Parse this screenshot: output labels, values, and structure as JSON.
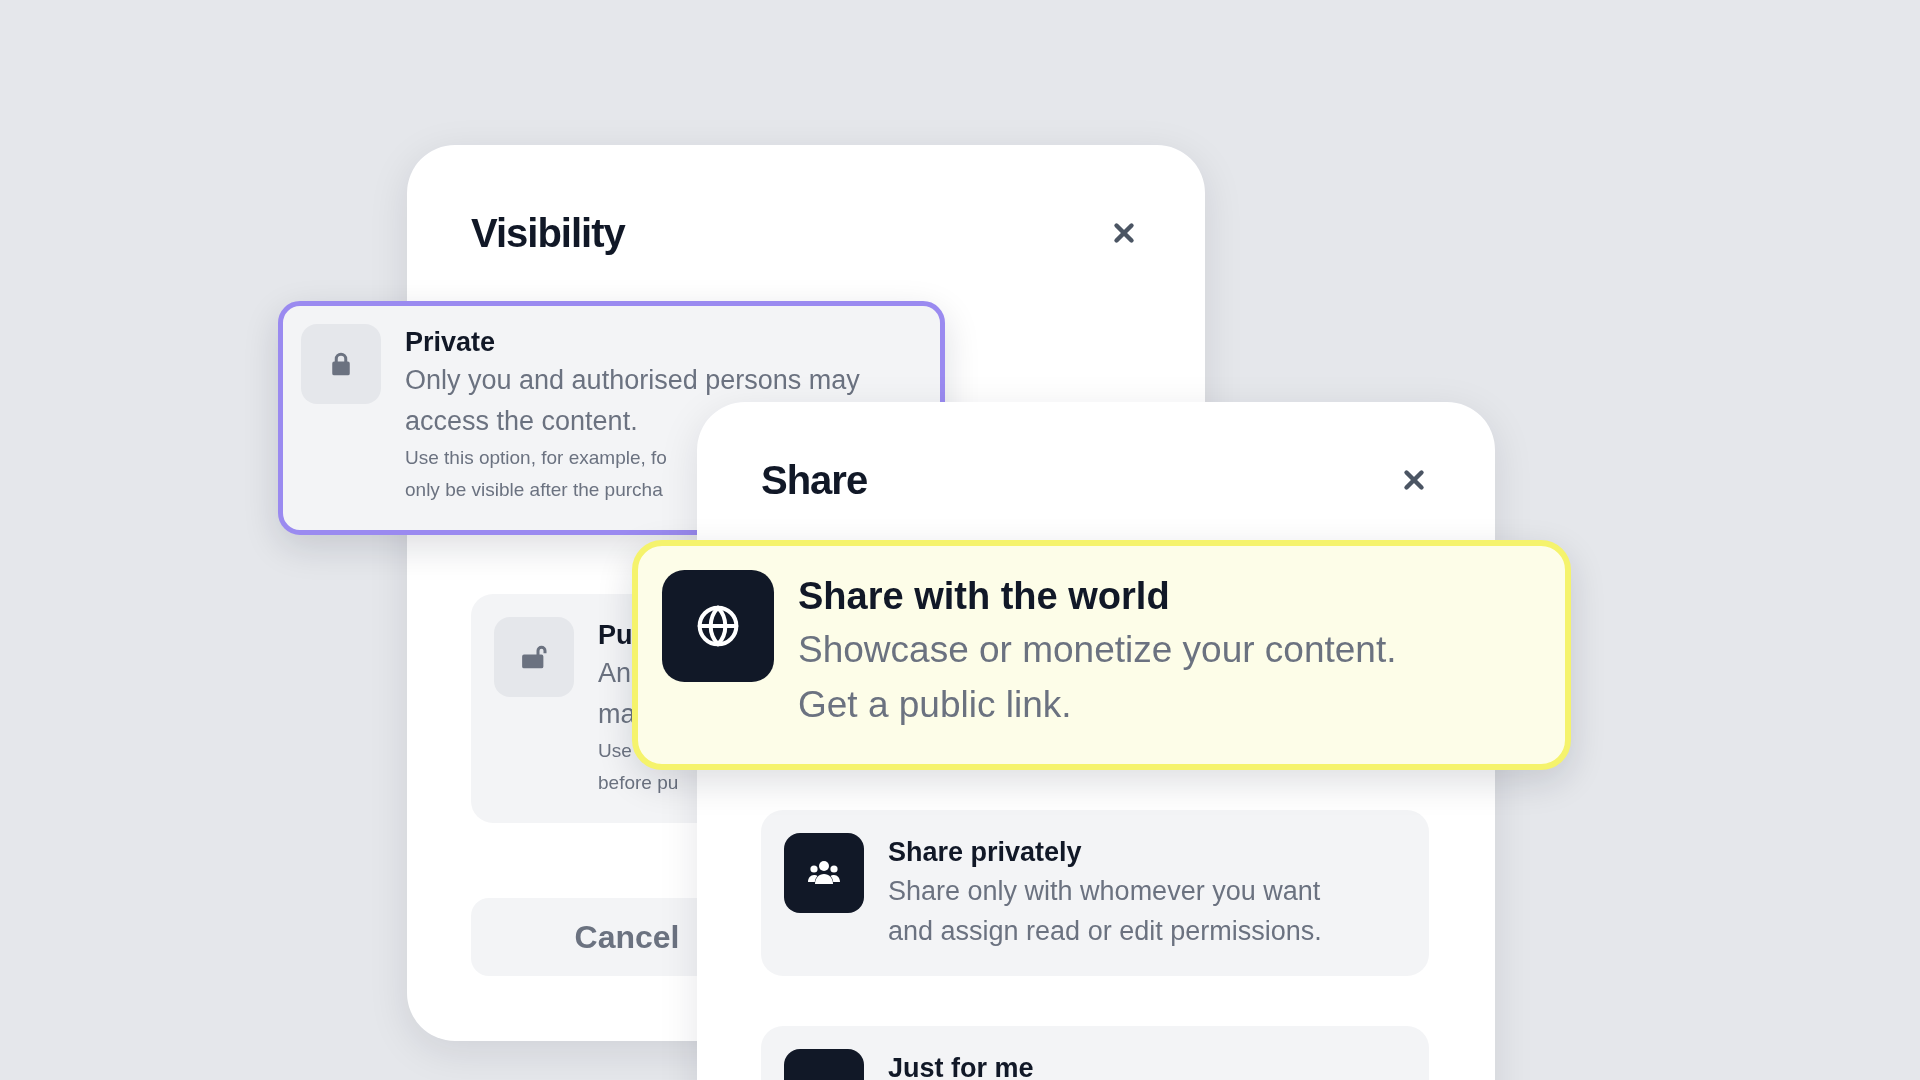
{
  "visibility_dialog": {
    "title": "Visibility",
    "options": [
      {
        "kind": "lock",
        "title": "Private",
        "description_lines": [
          "Only you and authorised persons may",
          "access the content."
        ],
        "note_lines": [
          "Use this option, for example, fo",
          "only be visible after the purcha"
        ],
        "selected": true
      },
      {
        "kind": "unlock",
        "title": "Pu",
        "description_lines": [
          "An",
          "ma"
        ],
        "note_lines": [
          "Use",
          "before pu"
        ],
        "selected": false
      }
    ],
    "cancel_button": "Cancel"
  },
  "share_dialog": {
    "title": "Share",
    "options": [
      {
        "kind": "globe",
        "title": "Share with the world",
        "description_lines": [
          "Showcase or monetize your content.",
          "Get a public link."
        ],
        "selected": true
      },
      {
        "kind": "group",
        "title": "Share privately",
        "description_lines": [
          "Share only with whomever you want",
          "and assign read or edit permissions."
        ],
        "selected": false
      },
      {
        "kind": "blank",
        "title": "Just for me",
        "selected": false
      }
    ]
  }
}
